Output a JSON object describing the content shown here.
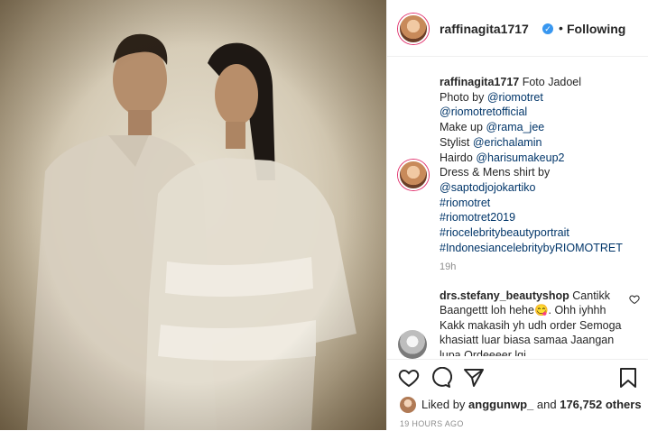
{
  "post": {
    "username": "raffinagita1717",
    "verified_mark": "✓",
    "dot": "•",
    "follow_status": "Following",
    "more": "•••"
  },
  "caption": {
    "username": "raffinagita1717",
    "title": "Foto Jadoel",
    "photo_by_label": "Photo by",
    "photo_by": "@riomotret",
    "handle2": "@riomotretofficial",
    "makeup_label": "Make up",
    "makeup": "@rama_jee",
    "stylist_label": "Stylist",
    "stylist": "@erichalamin",
    "hairdo_label": "Hairdo",
    "hairdo": "@harisumakeup2",
    "dress_label": "Dress & Mens shirt by",
    "dress": "@saptodjojokartiko",
    "tags": [
      "#riomotret",
      "#riomotret2019",
      "#riocelebritybeautyportrait",
      "#IndonesiancelebritybyRIOMOTRET"
    ],
    "time": "19h"
  },
  "comment": {
    "username": "drs.stefany_beautyshop",
    "text": "Cantikk Baangettt loh hehe😋. Ohh iyhhh Kakk makasih yh udh order Semoga khasiatt luar biasa samaa Jaangan lupa Ordeeeer lgi"
  },
  "likes": {
    "prefix": "Liked by",
    "user": "anggunwp_",
    "middle": "and",
    "count": "176,752 others"
  },
  "time_ago": "19 HOURS AGO"
}
